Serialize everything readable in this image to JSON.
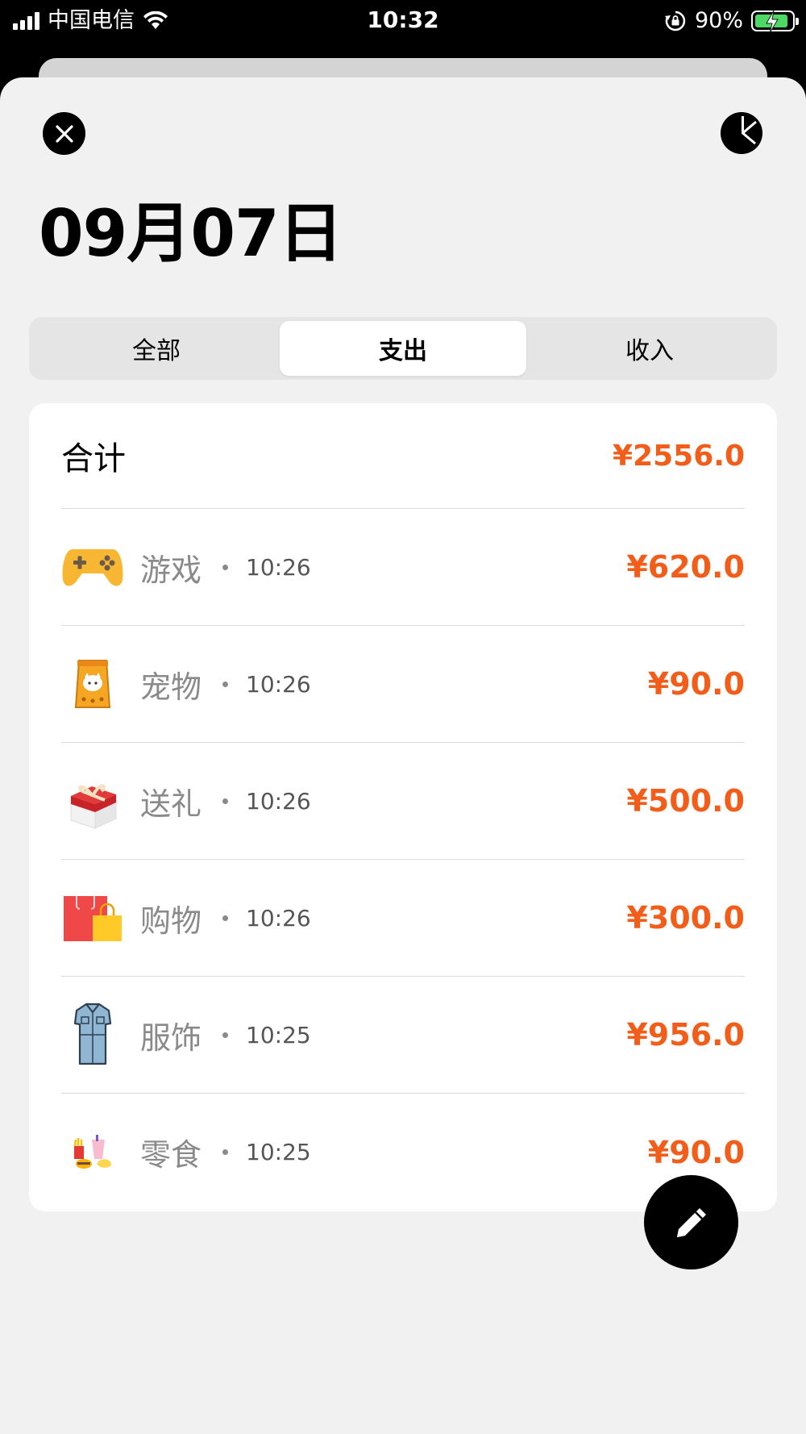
{
  "status_bar": {
    "carrier": "中国电信",
    "time": "10:32",
    "battery": "90%",
    "battery_level": 0.9
  },
  "header": {
    "date_title": "09月07日"
  },
  "tabs": [
    {
      "label": "全部",
      "active": false
    },
    {
      "label": "支出",
      "active": true
    },
    {
      "label": "收入",
      "active": false
    }
  ],
  "summary": {
    "total_label": "合计",
    "total_amount": "¥2556.0"
  },
  "records": [
    {
      "icon": "gamepad-icon",
      "category": "游戏",
      "time": "10:26",
      "amount": "¥620.0"
    },
    {
      "icon": "pet-food-bag-icon",
      "category": "宠物",
      "time": "10:26",
      "amount": "¥90.0"
    },
    {
      "icon": "gift-box-icon",
      "category": "送礼",
      "time": "10:26",
      "amount": "¥500.0"
    },
    {
      "icon": "shopping-bags-icon",
      "category": "购物",
      "time": "10:26",
      "amount": "¥300.0"
    },
    {
      "icon": "dress-icon",
      "category": "服饰",
      "time": "10:25",
      "amount": "¥956.0"
    },
    {
      "icon": "snacks-icon",
      "category": "零食",
      "time": "10:25",
      "amount": "¥90.0"
    }
  ],
  "colors": {
    "accent": "#f35d1a",
    "sheet_background": "#f1f1f1",
    "card_background": "#ffffff",
    "battery_green": "#4cd964"
  }
}
